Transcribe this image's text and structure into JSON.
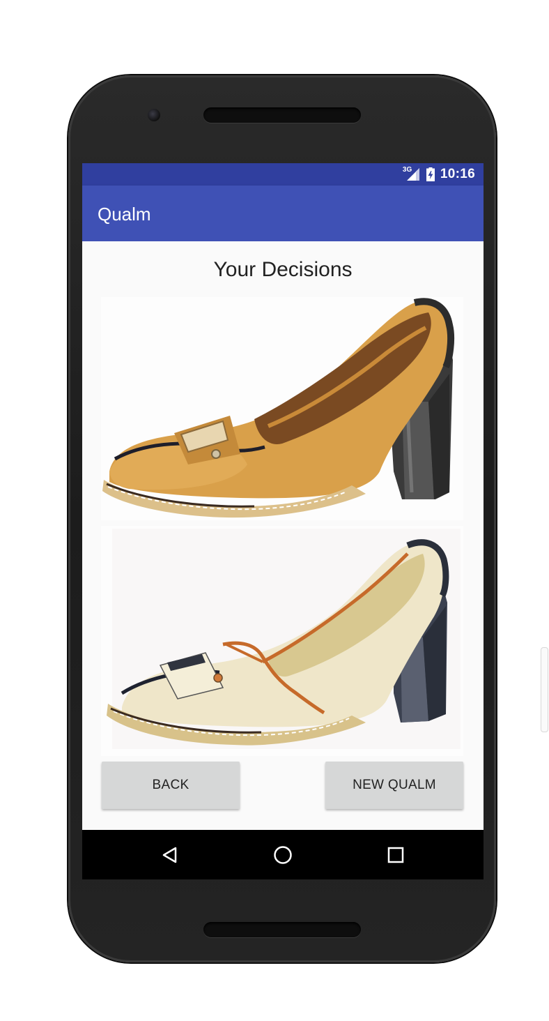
{
  "status_bar": {
    "network": "3G",
    "time": "10:16",
    "color": "#303f9f"
  },
  "app_bar": {
    "title": "Qualm",
    "color": "#3f51b5"
  },
  "main": {
    "heading": "Your Decisions",
    "images": [
      {
        "subject": "tan leather loafer pump with dark block heel",
        "icon": "shoe-image"
      },
      {
        "subject": "cream leather loafer pump with orange trim and dark block heel",
        "icon": "shoe-image"
      }
    ]
  },
  "buttons": {
    "back": "BACK",
    "new_qualm": "NEW QUALM"
  },
  "nav_bar": {
    "items": [
      "back-icon",
      "home-icon",
      "recents-icon"
    ]
  }
}
